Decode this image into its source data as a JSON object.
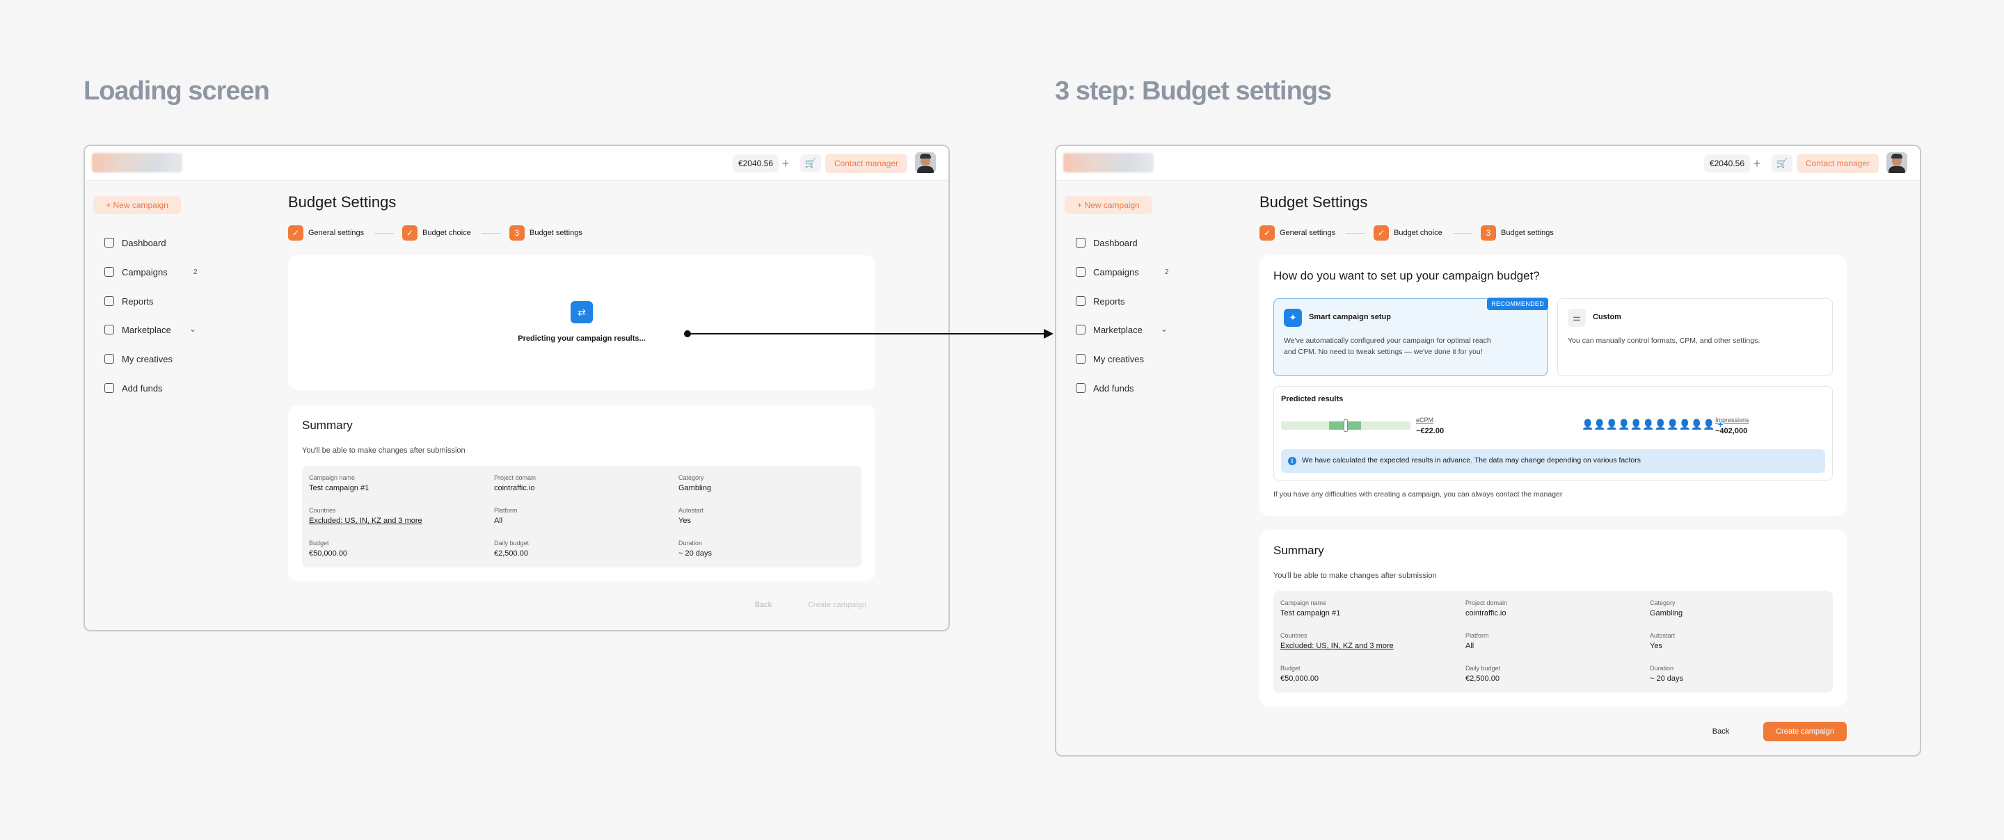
{
  "titles": {
    "left": "Loading screen",
    "right": "3 step: Budget settings"
  },
  "topbar": {
    "balance": "€2040.56",
    "plus": "+",
    "cart": "🛒",
    "contact": "Contact manager"
  },
  "sidebar": {
    "new_campaign": "+ New campaign",
    "items": [
      {
        "label": "Dashboard",
        "icon": "home-icon"
      },
      {
        "label": "Campaigns",
        "icon": "bag-icon",
        "count": "2"
      },
      {
        "label": "Reports",
        "icon": "document-icon"
      },
      {
        "label": "Marketplace",
        "icon": "store-icon",
        "chevron": "⌄"
      },
      {
        "label": "My creatives",
        "icon": "image-icon"
      },
      {
        "label": "Add funds",
        "icon": "card-icon"
      }
    ]
  },
  "page": {
    "title": "Budget Settings"
  },
  "steps": [
    {
      "badge": "✓",
      "label": "General settings"
    },
    {
      "badge": "✓",
      "label": "Budget choice"
    },
    {
      "badge": "3",
      "label": "Budget settings"
    }
  ],
  "loading": {
    "icon": "⇄",
    "text": "Predicting your campaign results..."
  },
  "budget": {
    "question": "How do you want to set up your campaign budget?",
    "smart": {
      "title": "Smart campaign setup",
      "badge": "RECOMMENDED",
      "desc": "We've automatically configured your campaign for optimal reach and CPM. No need to tweak settings — we've done it for you!",
      "icon": "✦"
    },
    "custom": {
      "title": "Custom",
      "desc": "You can manually control formats, CPM, and other settings.",
      "icon": "⚌"
    },
    "predicted": {
      "title": "Predicted results",
      "ecpm_label": "eCPM",
      "ecpm_value": "~€22.00",
      "ecpm_range": {
        "fill_start": 0.37,
        "fill_end": 0.62,
        "thumb": 0.5
      },
      "people": "👤👤👤👤👤👤👤👤👤👤👤 +",
      "impressions_label": "Impressions",
      "impressions_value": "~402,000",
      "info": "We have calculated the expected results in advance. The data may change depending on various factors"
    },
    "help": "If you have any difficulties with creating a campaign, you can always contact the manager"
  },
  "summary": {
    "title": "Summary",
    "subtitle": "You'll be able to make changes after submission",
    "fields": {
      "campaign_name": {
        "label": "Campaign name",
        "value": "Test campaign #1"
      },
      "project_domain": {
        "label": "Project domain",
        "value": "cointraffic.io"
      },
      "category": {
        "label": "Category",
        "value": "Gambling"
      },
      "countries": {
        "label": "Countries",
        "value": "Excluded: US, IN, KZ and 3 more"
      },
      "platform": {
        "label": "Platform",
        "value": "All"
      },
      "autostart": {
        "label": "Autostart",
        "value": "Yes"
      },
      "budget": {
        "label": "Budget",
        "value": "€50,000.00"
      },
      "daily_budget": {
        "label": "Daily budget",
        "value": "€2,500.00"
      },
      "duration": {
        "label": "Duration",
        "value": "~ 20 days"
      }
    }
  },
  "footer": {
    "back": "Back",
    "create": "Create campaign"
  },
  "colors": {
    "accent": "#f27a39",
    "blue": "#1f83e6",
    "muted_title": "#8e96a3"
  }
}
